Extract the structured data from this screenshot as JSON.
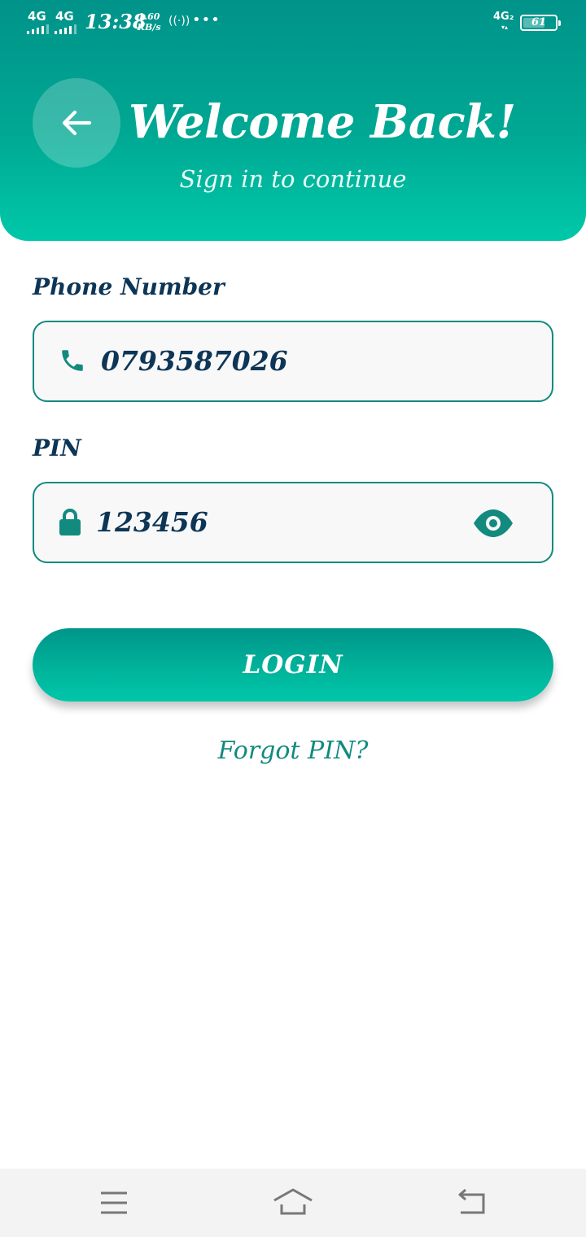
{
  "status_bar": {
    "network_1": "4G",
    "network_2": "4G",
    "time": "13:38",
    "speed_value": "1.60",
    "speed_unit": "KB/s",
    "network_right": "4G₂",
    "battery": "61"
  },
  "header": {
    "title": "Welcome Back!",
    "subtitle": "Sign in to continue"
  },
  "form": {
    "phone_label": "Phone Number",
    "phone_value": "0793587026",
    "pin_label": "PIN",
    "pin_value": "123456"
  },
  "actions": {
    "login_label": "LOGIN",
    "forgot_label": "Forgot PIN?"
  },
  "colors": {
    "primary": "#00a893",
    "primary_dark": "#00938a",
    "text_dark": "#0d3556",
    "link": "#128a7e"
  },
  "icons": {
    "back": "arrow-left-icon",
    "phone": "phone-icon",
    "lock": "lock-icon",
    "visibility": "eye-icon",
    "nav_menu": "menu-icon",
    "nav_home": "home-icon",
    "nav_back": "back-icon"
  }
}
